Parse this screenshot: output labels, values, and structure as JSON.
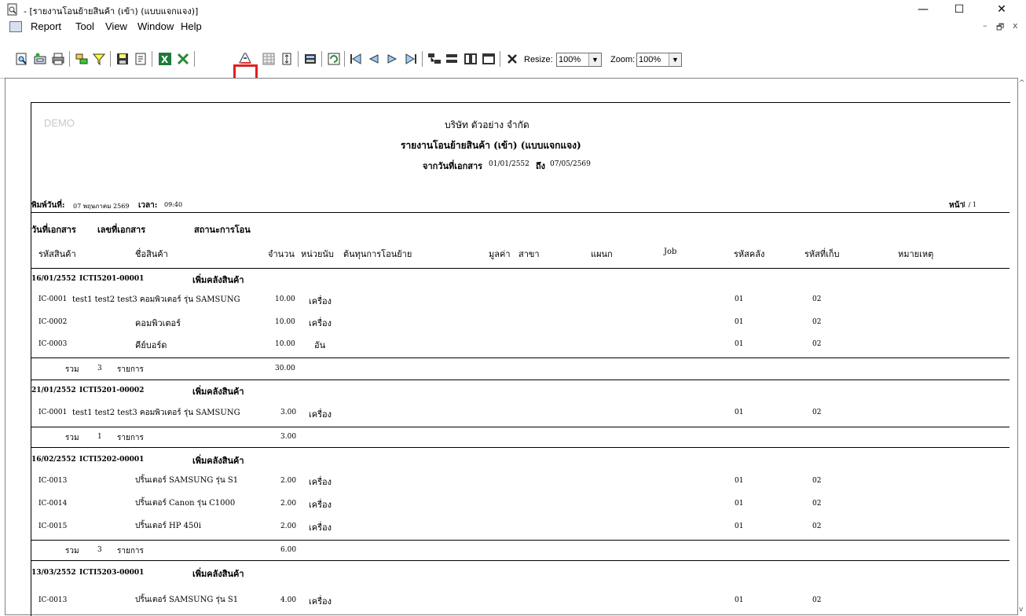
{
  "window": {
    "title": "- [รายงานโอนย้ายสินค้า (เข้า) (แบบแจกแจง)]",
    "minimize": "—",
    "maximize": "☐",
    "close": "✕"
  },
  "menu": {
    "items": [
      "Report",
      "Tool",
      "View",
      "Window",
      "Help"
    ],
    "mdi_min": "–",
    "mdi_restore": "🗗",
    "mdi_close": "x"
  },
  "toolbar": {
    "resize_label": "Resize:",
    "resize_value": "100%",
    "zoom_label": "Zoom:",
    "zoom_value": "100%",
    "highlighted_button": "send-to-printer-icon"
  },
  "report": {
    "watermark": "DEMO",
    "company": "บริษัท ตัวอย่าง จำกัด",
    "title": "รายงานโอนย้ายสินค้า (เข้า) (แบบแจกแจง)",
    "date_range_label": "จากวันที่เอกสาร",
    "date_from": "01/01/2552",
    "date_to_label": "ถึง",
    "date_to": "07/05/2569",
    "print_date_label": "พิมพ์วันที่:",
    "print_date": "07 พฤษภาคม 2569",
    "print_time_label": "เวลา:",
    "print_time": "09:40",
    "page_label": "หน้า",
    "page_value": "1 / 1",
    "header1": {
      "doc_date": "วันที่เอกสาร",
      "doc_no": "เลขที่เอกสาร",
      "status": "สถานะการโอน"
    },
    "header2": {
      "code": "รหัสสินค้า",
      "name": "ชื่อสินค้า",
      "qty": "จำนวน",
      "unit": "หน่วยนับ",
      "cost": "ต้นทุนการโอนย้าย",
      "value": "มูลค่า",
      "branch": "สาขา",
      "dept": "แผนก",
      "job": "Job",
      "wh": "รหัสคลัง",
      "loc": "รหัสที่เก็บ",
      "note": "หมายเหตุ"
    },
    "sum_label": "รวม",
    "items_label": "รายการ",
    "groups": [
      {
        "date": "16/01/2552",
        "doc": "ICTI5201-00001",
        "status": "เพิ่มคลังสินค้า",
        "rows": [
          {
            "code": "IC-0001",
            "name": "test1 test2 test3 คอมพิวเตอร์ รุ่น SAMSUNG",
            "qty": "10.00",
            "unit": "เครื่อง",
            "wh": "01",
            "loc": "02"
          },
          {
            "code": "IC-0002",
            "name": "คอมพิวเตอร์",
            "qty": "10.00",
            "unit": "เครื่อง",
            "wh": "01",
            "loc": "02"
          },
          {
            "code": "IC-0003",
            "name": "คีย์บอร์ด",
            "qty": "10.00",
            "unit": "อัน",
            "wh": "01",
            "loc": "02"
          }
        ],
        "count": "3",
        "total": "30.00"
      },
      {
        "date": "21/01/2552",
        "doc": "ICTI5201-00002",
        "status": "เพิ่มคลังสินค้า",
        "rows": [
          {
            "code": "IC-0001",
            "name": "test1 test2 test3 คอมพิวเตอร์ รุ่น SAMSUNG",
            "qty": "3.00",
            "unit": "เครื่อง",
            "wh": "01",
            "loc": "02"
          }
        ],
        "count": "1",
        "total": "3.00"
      },
      {
        "date": "16/02/2552",
        "doc": "ICTI5202-00001",
        "status": "เพิ่มคลังสินค้า",
        "rows": [
          {
            "code": "IC-0013",
            "name": "ปริ้นเตอร์ SAMSUNG รุ่น S1",
            "qty": "2.00",
            "unit": "เครื่อง",
            "wh": "01",
            "loc": "02"
          },
          {
            "code": "IC-0014",
            "name": "ปริ้นเตอร์ Canon รุ่น C1000",
            "qty": "2.00",
            "unit": "เครื่อง",
            "wh": "01",
            "loc": "02"
          },
          {
            "code": "IC-0015",
            "name": "ปริ้นเตอร์ HP 450i",
            "qty": "2.00",
            "unit": "เครื่อง",
            "wh": "01",
            "loc": "02"
          }
        ],
        "count": "3",
        "total": "6.00"
      },
      {
        "date": "13/03/2552",
        "doc": "ICTI5203-00001",
        "status": "เพิ่มคลังสินค้า",
        "rows": [
          {
            "code": "IC-0013",
            "name": "ปริ้นเตอร์ SAMSUNG รุ่น S1",
            "qty": "4.00",
            "unit": "เครื่อง",
            "wh": "01",
            "loc": "02"
          }
        ]
      }
    ]
  }
}
